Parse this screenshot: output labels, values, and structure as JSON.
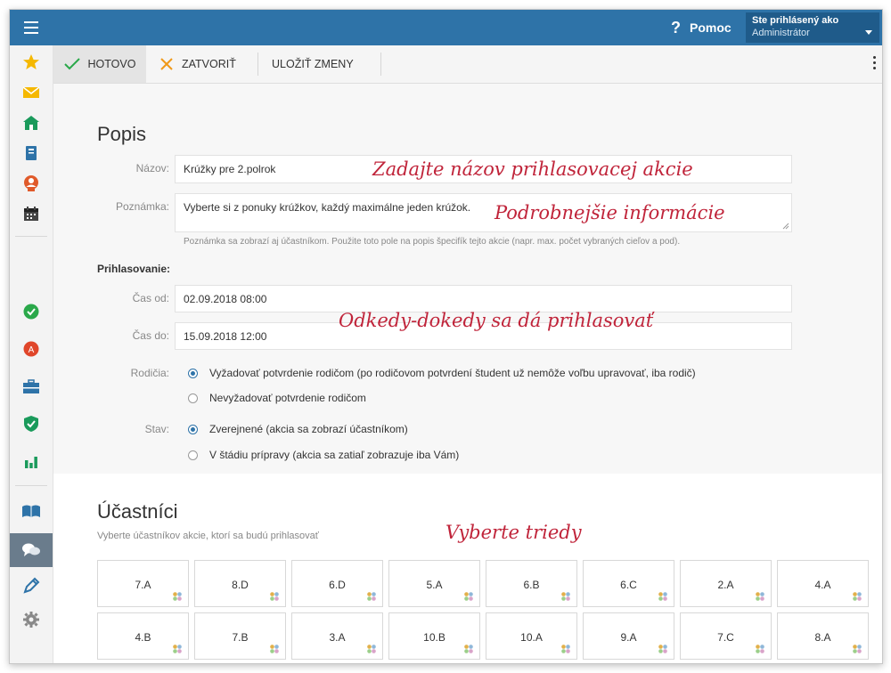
{
  "header": {
    "help_label": "Pomoc",
    "help_icon": "question-icon",
    "user_line1": "Ste prihlásený ako",
    "user_line2": "Administrátor"
  },
  "sidebar": {
    "items": [
      {
        "icon": "star-icon",
        "color": "#f5b800"
      },
      {
        "icon": "mail-icon",
        "color": "#f5b800"
      },
      {
        "icon": "home-icon",
        "color": "#1a9a5b"
      },
      {
        "icon": "notebook-icon",
        "color": "#2e73a8"
      },
      {
        "icon": "person-badge-icon",
        "color": "#e05a2a"
      },
      {
        "icon": "calendar-icon",
        "color": "#444444"
      },
      {
        "icon": "check-circle-icon",
        "color": "#2aa84a"
      },
      {
        "icon": "grade-icon",
        "color": "#e0462a"
      },
      {
        "icon": "briefcase-icon",
        "color": "#2e73a8"
      },
      {
        "icon": "shield-check-icon",
        "color": "#1a9a5b"
      },
      {
        "icon": "bar-chart-icon",
        "color": "#1a9a5b"
      },
      {
        "icon": "open-book-icon",
        "color": "#2e73a8"
      },
      {
        "icon": "chat-icon",
        "color": "#ffffff"
      },
      {
        "icon": "pencil-icon",
        "color": "#2e73a8"
      },
      {
        "icon": "gear-icon",
        "color": "#888888"
      }
    ]
  },
  "toolbar": {
    "done_label": "HOTOVO",
    "close_label": "ZATVORIŤ",
    "save_label": "ULOŽIŤ ZMENY"
  },
  "popis": {
    "title": "Popis",
    "name_label": "Názov:",
    "name_value": "Krúžky pre 2.polrok",
    "note_label": "Poznámka:",
    "note_value": "Vyberte si z ponuky krúžkov, každý maximálne jeden krúžok.",
    "note_hint": "Poznámka sa zobrazí aj účastníkom. Použite toto pole na popis špecifík tejto akcie (napr. max. počet vybraných cieľov a pod)."
  },
  "prihlasovanie": {
    "title": "Prihlasovanie:",
    "from_label": "Čas od:",
    "from_value": "02.09.2018 08:00",
    "to_label": "Čas do:",
    "to_value": "15.09.2018 12:00",
    "parents_label": "Rodičia:",
    "parents_options": [
      {
        "label": "Vyžadovať potvrdenie rodičom (po rodičovom potvrdení študent už nemôže voľbu upravovať, iba rodič)",
        "selected": true
      },
      {
        "label": "Nevyžadovať potvrdenie rodičom",
        "selected": false
      }
    ],
    "status_label": "Stav:",
    "status_options": [
      {
        "label": "Zverejnené (akcia sa zobrazí účastníkom)",
        "selected": true
      },
      {
        "label": "V štádiu prípravy (akcia sa zatiaľ zobrazuje iba Vám)",
        "selected": false
      }
    ]
  },
  "annotations": {
    "name": "Zadajte názov prihlasovacej akcie",
    "note": "Podrobnejšie informácie",
    "time": "Odkedy-dokedy sa dá prihlasovať",
    "classes": "Vyberte triedy"
  },
  "ucastnici": {
    "title": "Účastníci",
    "subtitle": "Vyberte účastníkov akcie, ktorí sa budú prihlasovať",
    "classes_row1": [
      "7.A",
      "8.D",
      "6.D",
      "5.A",
      "6.B",
      "6.C",
      "2.A",
      "4.A"
    ],
    "classes_row2": [
      "4.B",
      "7.B",
      "3.A",
      "10.B",
      "10.A",
      "9.A",
      "7.C",
      "8.A"
    ],
    "tile_icon": "group-icon"
  },
  "colors": {
    "header": "#2e73a8",
    "annotation": "#c0243a",
    "radio_selected": "#2e73a8"
  }
}
